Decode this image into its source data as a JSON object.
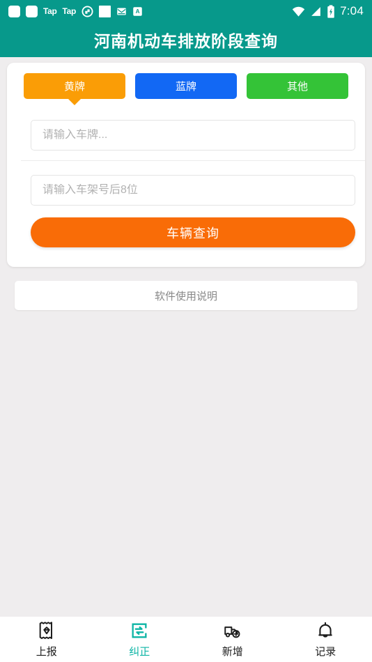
{
  "status_bar": {
    "left_icons": [
      "app-square-icon",
      "app-square-icon",
      "tap-badge",
      "tap-badge",
      "sync-icon",
      "app-square-icon",
      "mail-icon",
      "translate-icon"
    ],
    "tap_label": "Tap",
    "right_icons": [
      "wifi-icon",
      "signal-icon",
      "battery-charging-icon"
    ],
    "time": "7:04"
  },
  "header": {
    "title": "河南机动车排放阶段查询",
    "background": "#07998b"
  },
  "query_card": {
    "tabs": [
      {
        "label": "黄牌",
        "color": "#fa9d06",
        "selected": true
      },
      {
        "label": "蓝牌",
        "color": "#1268f4",
        "selected": false
      },
      {
        "label": "其他",
        "color": "#34c337",
        "selected": false
      }
    ],
    "plate_input": {
      "value": "",
      "placeholder": "请输入车牌..."
    },
    "vin_input": {
      "value": "",
      "placeholder": "请输入车架号后8位"
    },
    "query_button": {
      "label": "车辆查询",
      "color": "#f96c07"
    }
  },
  "info_card": {
    "label": "软件使用说明"
  },
  "bottom_nav": {
    "active_color": "#0db5a5",
    "items": [
      {
        "label": "上报",
        "icon": "receipt-diamond-icon",
        "active": false
      },
      {
        "label": "纠正",
        "icon": "document-edit-icon",
        "active": true
      },
      {
        "label": "新增",
        "icon": "truck-plus-icon",
        "active": false
      },
      {
        "label": "记录",
        "icon": "bell-icon",
        "active": false
      }
    ]
  }
}
